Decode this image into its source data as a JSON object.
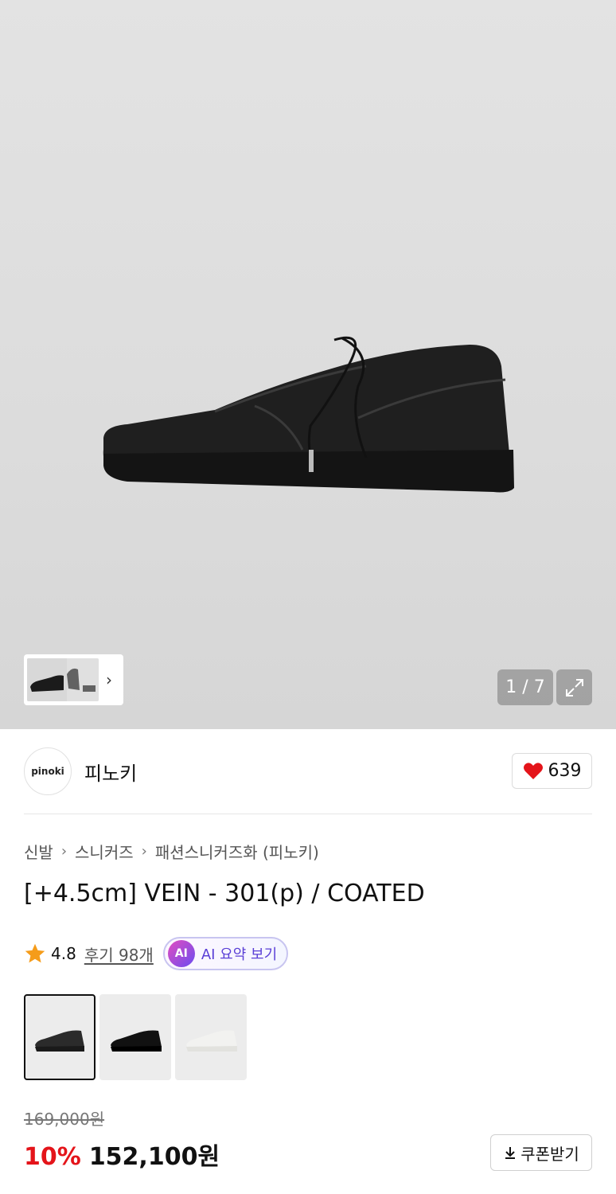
{
  "gallery": {
    "counter": "1 / 7",
    "thumb_more_icon": "chevron-right-icon",
    "expand_icon": "expand-icon"
  },
  "brand": {
    "logo_text": "pinoki",
    "name": "피노키",
    "likes": "639",
    "like_icon": "heart-icon",
    "like_color": "#e4141a"
  },
  "breadcrumb": [
    "신발",
    "스니커즈",
    "패션스니커즈화 (피노키)"
  ],
  "product": {
    "title": "[+4.5cm] VEIN - 301(p) / COATED",
    "rating": "4.8",
    "reviews": "후기 98개",
    "ai_badge": "AI",
    "ai_label": "AI 요약 보기"
  },
  "options": [
    {
      "name": "coated-black",
      "shoe_color": "#2b2b2b",
      "selected": true
    },
    {
      "name": "black",
      "shoe_color": "#111111",
      "selected": false
    },
    {
      "name": "white",
      "shoe_color": "#f2f2f0",
      "selected": false
    }
  ],
  "pricing": {
    "original": "169,000원",
    "discount": "10%",
    "price": "152,100원",
    "coupon_label": "쿠폰받기",
    "discount_color": "#e4141a"
  }
}
